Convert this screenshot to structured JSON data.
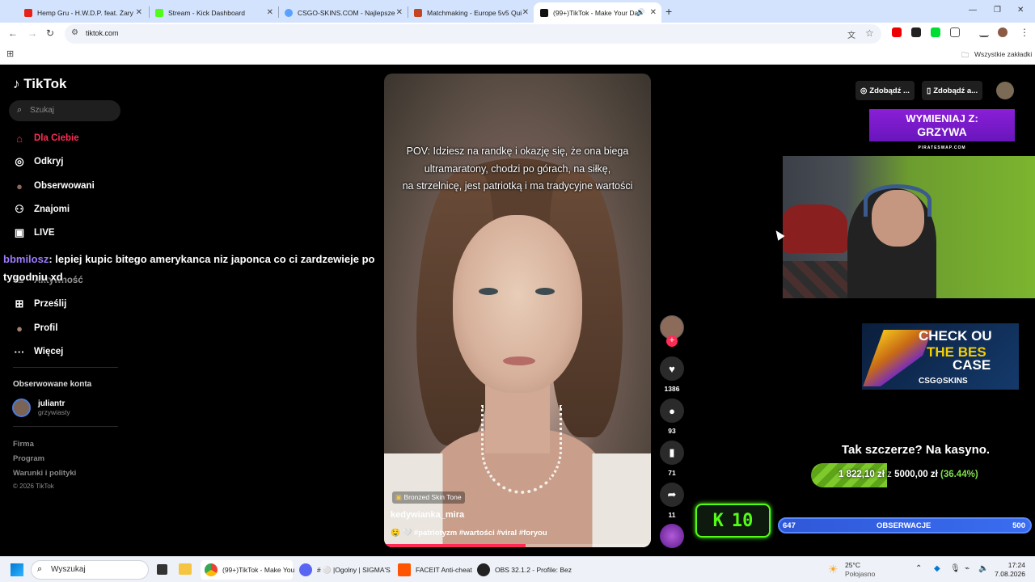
{
  "browser": {
    "tabs": [
      {
        "title": "Hemp Gru - H.W.D.P. feat. Żary",
        "color": "#e62117"
      },
      {
        "title": "Stream - Kick Dashboard",
        "color": "#53fc18"
      },
      {
        "title": "CSGO-SKINS.COM - Najlepsze",
        "color": "#5aa0ff"
      },
      {
        "title": "Matchmaking - Europe 5v5 Qui",
        "color": "#c4451f"
      },
      {
        "title": "(99+)TikTok - Make Your Da",
        "color": "#111111"
      }
    ],
    "new_tab_label": "+",
    "url": "tiktok.com",
    "bookmarks_all": "Wszystkie zakładki",
    "window_controls": {
      "minimize": "—",
      "restore": "❐",
      "close": "✕"
    }
  },
  "tiktok": {
    "logo": "TikTok",
    "search_placeholder": "Szukaj",
    "nav": [
      {
        "label": "Dla Ciebie",
        "icon": "home-icon",
        "glyph": "⌂"
      },
      {
        "label": "Odkryj",
        "icon": "compass-icon",
        "glyph": "◎"
      },
      {
        "label": "Obserwowani",
        "icon": "avatar-icon",
        "glyph": "●"
      },
      {
        "label": "Znajomi",
        "icon": "friends-icon",
        "glyph": "⚇"
      },
      {
        "label": "LIVE",
        "icon": "live-icon",
        "glyph": "▣"
      },
      {
        "label": "Aktywność",
        "icon": "activity-icon",
        "glyph": "✉"
      },
      {
        "label": "Prześlij",
        "icon": "upload-icon",
        "glyph": "⊞"
      },
      {
        "label": "Profil",
        "icon": "profile-icon",
        "glyph": "●"
      },
      {
        "label": "Więcej",
        "icon": "more-icon",
        "glyph": "···"
      }
    ],
    "following_heading": "Obserwowane konta",
    "following": [
      {
        "name": "juliantr",
        "handle": "grzywiasty"
      }
    ],
    "footer": [
      "Firma",
      "Program",
      "Warunki i polityki",
      "© 2026 TikTok"
    ],
    "top_buttons": [
      "Zdobądź ...",
      "Zdobądź a..."
    ]
  },
  "video": {
    "caption_lines": [
      "POV: Idziesz na randkę i okazję się, że ona biega",
      "ultramaratony, chodzi po górach, na siłkę,",
      "na strzelnicę, jest patriotką i ma tradycyjne wartości"
    ],
    "effect": "Bronzed Skin Tone",
    "author": "kedywianka_mira",
    "tags": "🤤 🤍 #patriotyzm #wartości #viral #foryou",
    "progress": 0.53,
    "likes": "1386",
    "comments": "93",
    "saves": "71",
    "shares": "11"
  },
  "overlay": {
    "chat_user": "bbmilosz",
    "chat_text": ": lepiej kupic bitego amerykanca niz japonca co ci zardzewieje po tygodniu xd",
    "banner_line1": "WYMIENIAJ Z:",
    "banner_line2": "GRZYWA",
    "banner_sub": "PIRATESWAP.COM",
    "csgo_line1": "CHECK OU",
    "csgo_line2": "THE BES",
    "csgo_line3": "CASE",
    "csgo_logo": "CSG⊙SKINS",
    "kasyno_title": "Tak szczerze? Na kasyno.",
    "kasyno_current": "1 822,10 zł",
    "kasyno_sep": "z",
    "kasyno_goal": "5000,00 zł",
    "kasyno_pct": "(36.44%)",
    "kasyno_progress": 0.3644,
    "kick_count": "10",
    "obs_left": "647",
    "obs_label": "OBSERWACJE",
    "obs_right": "500"
  },
  "taskbar": {
    "search_placeholder": "Wyszukaj",
    "apps": [
      {
        "label": "(99+)TikTok - Make You",
        "color": "#4285f4"
      },
      {
        "label": "# ⚪ |Ogolny | SIGMA'S",
        "color": "#5865f2"
      },
      {
        "label": "FACEIT Anti-cheat",
        "color": "#ff5500"
      },
      {
        "label": "OBS 32.1.2 - Profile: Bez",
        "color": "#222222"
      }
    ],
    "weather_temp": "25°C",
    "weather_desc": "Połojasno",
    "time": "17:24",
    "date": "7.08.2026"
  }
}
